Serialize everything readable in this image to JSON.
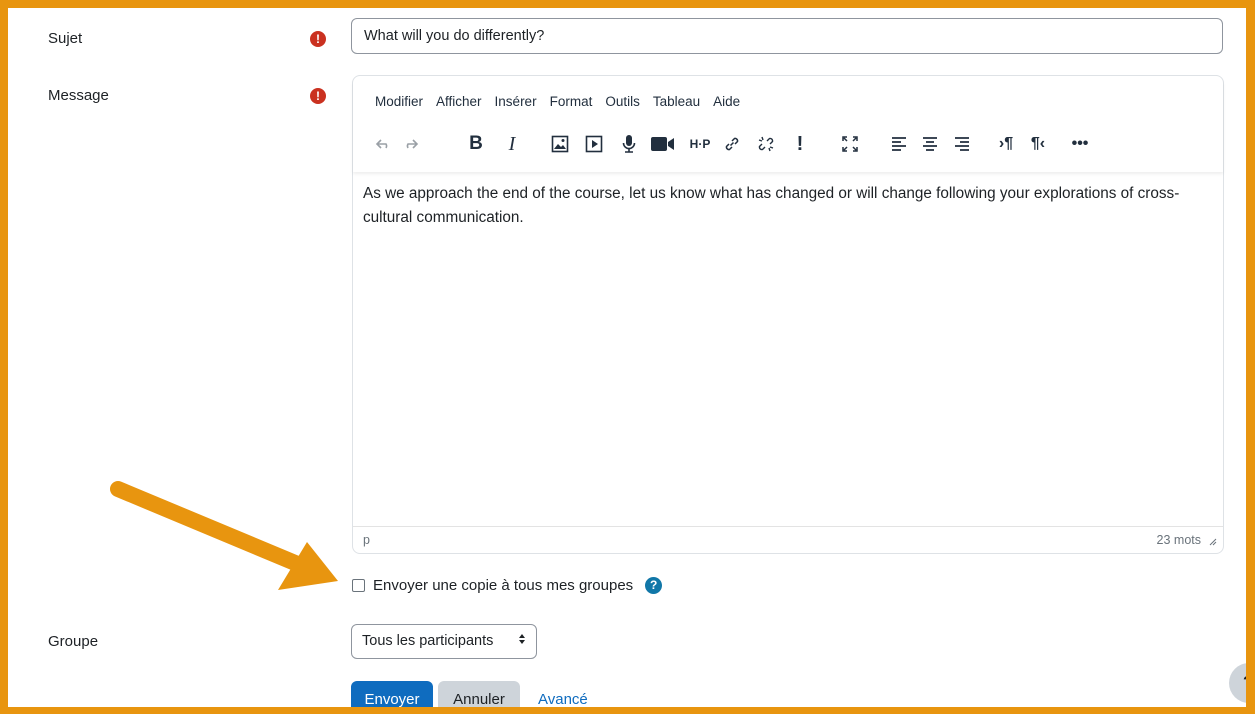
{
  "form": {
    "subject_label": "Sujet",
    "subject_value": "What will you do differently?",
    "message_label": "Message",
    "group_label": "Groupe",
    "group_value": "Tous les participants",
    "copy_label": "Envoyer une copie à tous mes groupes",
    "required_glyph": "!",
    "help_glyph": "?"
  },
  "editor": {
    "menu": [
      "Modifier",
      "Afficher",
      "Insérer",
      "Format",
      "Outils",
      "Tableau",
      "Aide"
    ],
    "toolbar_icons": [
      "undo-icon",
      "redo-icon",
      "bold-icon",
      "italic-icon",
      "image-icon",
      "media-icon",
      "record-audio-icon",
      "record-video-icon",
      "h5p-icon",
      "link-icon",
      "unlink-icon",
      "exclamation-icon",
      "fullscreen-icon",
      "align-left-icon",
      "align-center-icon",
      "align-right-icon",
      "ltr-icon",
      "rtl-icon",
      "more-icon"
    ],
    "content": "As we approach the end of the course, let us know what has changed or will change following your explorations of cross-cultural communication.",
    "status_path": "p",
    "word_count": "23 mots"
  },
  "buttons": {
    "submit": "Envoyer",
    "cancel": "Annuler",
    "advanced": "Avancé"
  },
  "colors": {
    "frame": "#e8950f",
    "primary": "#0f6cbf",
    "required": "#ca3120",
    "help": "#1177a8"
  }
}
